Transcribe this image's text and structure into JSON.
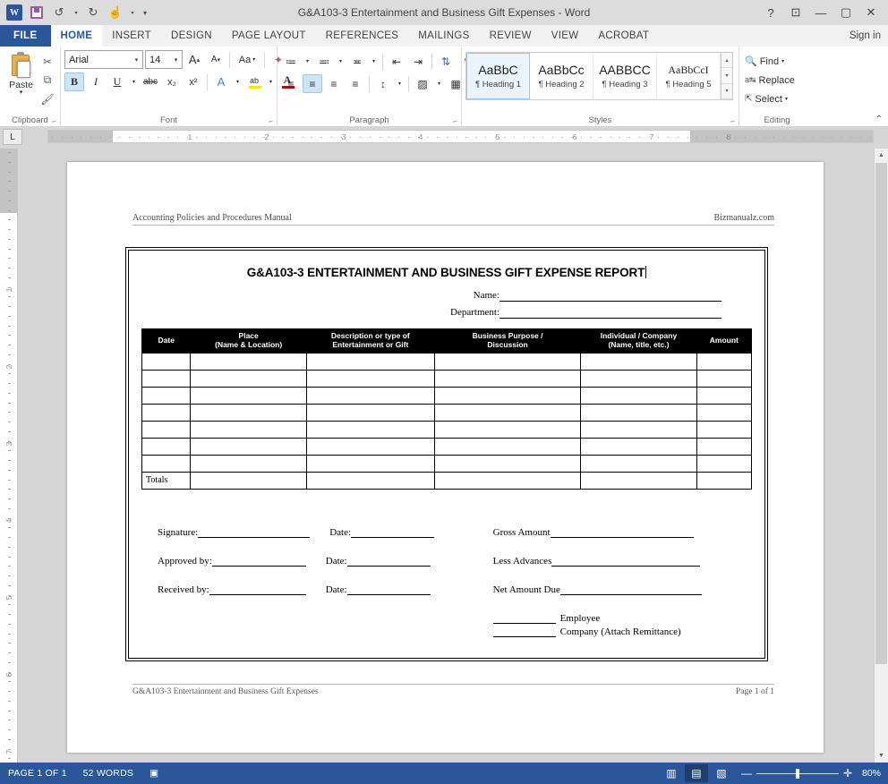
{
  "window": {
    "title": "G&A103-3 Entertainment and Business Gift Expenses - Word",
    "quick_access": [
      {
        "name": "word-logo-icon",
        "glyph": "W"
      },
      {
        "name": "save-icon",
        "glyph": ""
      },
      {
        "name": "undo-icon",
        "glyph": "↺"
      },
      {
        "name": "redo-icon",
        "glyph": "↻"
      },
      {
        "name": "touch-mode-icon",
        "glyph": "☝"
      },
      {
        "name": "qat-customize-icon",
        "glyph": "▾"
      }
    ],
    "buttons": {
      "help": "?",
      "ribbon_display": "⊡",
      "minimize": "—",
      "maximize": "▢",
      "close": "✕"
    }
  },
  "tabs": {
    "file": "FILE",
    "items": [
      {
        "label": "HOME",
        "active": true
      },
      {
        "label": "INSERT",
        "active": false
      },
      {
        "label": "DESIGN",
        "active": false
      },
      {
        "label": "PAGE LAYOUT",
        "active": false
      },
      {
        "label": "REFERENCES",
        "active": false
      },
      {
        "label": "MAILINGS",
        "active": false
      },
      {
        "label": "REVIEW",
        "active": false
      },
      {
        "label": "VIEW",
        "active": false
      },
      {
        "label": "ACROBAT",
        "active": false
      }
    ],
    "sign_in": "Sign in"
  },
  "ribbon": {
    "clipboard": {
      "label": "Clipboard",
      "paste": "Paste",
      "cut_icon": "✂",
      "copy_icon": "⧉",
      "format_painter_icon": "🖌"
    },
    "font": {
      "label": "Font",
      "font_name": "Arial",
      "font_size": "14",
      "grow_font": "A",
      "shrink_font": "A",
      "change_case": "Aa",
      "clear_formatting": "A",
      "bold": "B",
      "italic": "I",
      "underline": "U",
      "strikethrough": "abc",
      "subscript": "x₂",
      "superscript": "x²",
      "text_effects": "A",
      "highlight": "ab",
      "font_color": "A"
    },
    "paragraph": {
      "label": "Paragraph",
      "bullets": "≔",
      "numbering": "≕",
      "multilevel": "≖",
      "decrease_indent": "⇤",
      "increase_indent": "⇥",
      "sort": "↓",
      "show_marks": "¶",
      "align_left": "≡",
      "align_center": "≡",
      "align_right": "≡",
      "justify": "≡",
      "line_spacing": "↕",
      "shading": "▨",
      "borders": "▦"
    },
    "styles": {
      "label": "Styles",
      "items": [
        {
          "preview": "AaBbC",
          "name": "Heading 1",
          "selected": true,
          "serif": false
        },
        {
          "preview": "AaBbCc",
          "name": "Heading 2",
          "selected": false,
          "serif": false
        },
        {
          "preview": "AABBCC",
          "name": "Heading 3",
          "selected": false,
          "serif": false
        },
        {
          "preview": "AaBbCcI",
          "name": "Heading 5",
          "selected": false,
          "serif": true
        }
      ]
    },
    "editing": {
      "label": "Editing",
      "find": "Find",
      "replace": "Replace",
      "select": "Select"
    }
  },
  "ruler": {
    "horizontal_numbers": [
      "1",
      "1",
      "2",
      "3",
      "4",
      "5",
      "6",
      "7",
      "8"
    ],
    "vertical_numbers": [
      "1",
      "1",
      "2",
      "3",
      "4",
      "5",
      "6",
      "7"
    ],
    "tab_stop_selector": "L"
  },
  "document": {
    "header": {
      "left": "Accounting Policies and Procedures Manual",
      "right": "Bizmanualz.com"
    },
    "footer": {
      "left": "G&A103-3 Entertainment and Business Gift Expenses",
      "right": "Page 1 of 1"
    },
    "form": {
      "title": "G&A103-3 ENTERTAINMENT AND BUSINESS GIFT EXPENSE REPORT",
      "name_label": "Name:",
      "department_label": "Department:",
      "table": {
        "headers": [
          {
            "line1": "Date",
            "line2": ""
          },
          {
            "line1": "Place",
            "line2": "(Name & Location)"
          },
          {
            "line1": "Description or type of",
            "line2": "Entertainment or Gift"
          },
          {
            "line1": "Business Purpose /",
            "line2": "Discussion"
          },
          {
            "line1": "Individual / Company",
            "line2": "(Name, title, etc.)"
          },
          {
            "line1": "Amount",
            "line2": ""
          }
        ],
        "empty_rows": 7,
        "totals_label": "Totals"
      },
      "signatures": {
        "left_rows": [
          {
            "label": "Signature:",
            "date_label": "Date:"
          },
          {
            "label": "Approved by:",
            "date_label": "Date:"
          },
          {
            "label": "Received by:",
            "date_label": "Date:"
          }
        ],
        "right_rows": [
          "Gross Amount",
          "Less Advances",
          "Net Amount Due"
        ],
        "checkboxes": [
          "Employee",
          "Company (Attach Remittance)"
        ]
      }
    }
  },
  "status_bar": {
    "page": "PAGE 1 OF 1",
    "words": "52 WORDS",
    "proofing_icon": "proofing-errors-icon",
    "views": [
      {
        "name": "read-mode-view",
        "glyph": "▤",
        "active": false
      },
      {
        "name": "print-layout-view",
        "glyph": "▤",
        "active": true
      },
      {
        "name": "web-layout-view",
        "glyph": "▤",
        "active": false
      }
    ],
    "zoom_out": "—",
    "zoom_in": "✛",
    "zoom_level": "80%"
  },
  "colors": {
    "accent": "#2b579a",
    "tab_active_text": "#2b579a",
    "titlebar_bg": "#dcdcdc",
    "ribbon_bg": "#ffffff",
    "workspace_bg": "#d6d6d6"
  }
}
